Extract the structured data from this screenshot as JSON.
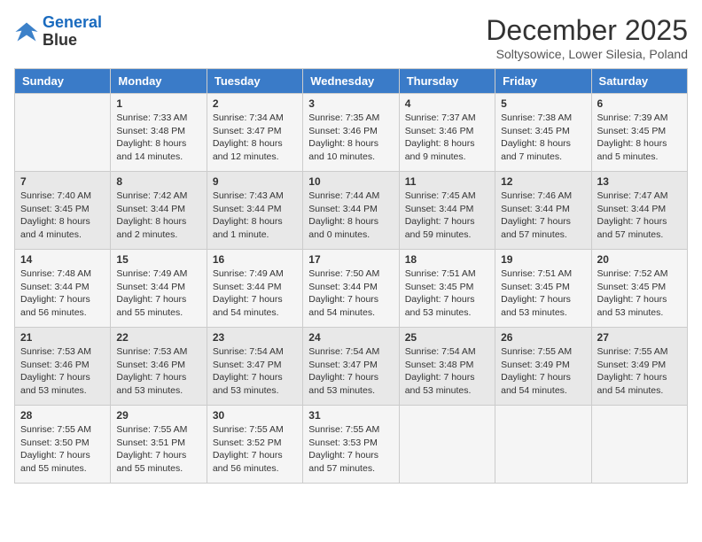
{
  "logo": {
    "line1": "General",
    "line2": "Blue"
  },
  "title": "December 2025",
  "subtitle": "Soltysowice, Lower Silesia, Poland",
  "days_header": [
    "Sunday",
    "Monday",
    "Tuesday",
    "Wednesday",
    "Thursday",
    "Friday",
    "Saturday"
  ],
  "weeks": [
    [
      {
        "day": "",
        "content": ""
      },
      {
        "day": "1",
        "content": "Sunrise: 7:33 AM\nSunset: 3:48 PM\nDaylight: 8 hours\nand 14 minutes."
      },
      {
        "day": "2",
        "content": "Sunrise: 7:34 AM\nSunset: 3:47 PM\nDaylight: 8 hours\nand 12 minutes."
      },
      {
        "day": "3",
        "content": "Sunrise: 7:35 AM\nSunset: 3:46 PM\nDaylight: 8 hours\nand 10 minutes."
      },
      {
        "day": "4",
        "content": "Sunrise: 7:37 AM\nSunset: 3:46 PM\nDaylight: 8 hours\nand 9 minutes."
      },
      {
        "day": "5",
        "content": "Sunrise: 7:38 AM\nSunset: 3:45 PM\nDaylight: 8 hours\nand 7 minutes."
      },
      {
        "day": "6",
        "content": "Sunrise: 7:39 AM\nSunset: 3:45 PM\nDaylight: 8 hours\nand 5 minutes."
      }
    ],
    [
      {
        "day": "7",
        "content": "Sunrise: 7:40 AM\nSunset: 3:45 PM\nDaylight: 8 hours\nand 4 minutes."
      },
      {
        "day": "8",
        "content": "Sunrise: 7:42 AM\nSunset: 3:44 PM\nDaylight: 8 hours\nand 2 minutes."
      },
      {
        "day": "9",
        "content": "Sunrise: 7:43 AM\nSunset: 3:44 PM\nDaylight: 8 hours\nand 1 minute."
      },
      {
        "day": "10",
        "content": "Sunrise: 7:44 AM\nSunset: 3:44 PM\nDaylight: 8 hours\nand 0 minutes."
      },
      {
        "day": "11",
        "content": "Sunrise: 7:45 AM\nSunset: 3:44 PM\nDaylight: 7 hours\nand 59 minutes."
      },
      {
        "day": "12",
        "content": "Sunrise: 7:46 AM\nSunset: 3:44 PM\nDaylight: 7 hours\nand 57 minutes."
      },
      {
        "day": "13",
        "content": "Sunrise: 7:47 AM\nSunset: 3:44 PM\nDaylight: 7 hours\nand 57 minutes."
      }
    ],
    [
      {
        "day": "14",
        "content": "Sunrise: 7:48 AM\nSunset: 3:44 PM\nDaylight: 7 hours\nand 56 minutes."
      },
      {
        "day": "15",
        "content": "Sunrise: 7:49 AM\nSunset: 3:44 PM\nDaylight: 7 hours\nand 55 minutes."
      },
      {
        "day": "16",
        "content": "Sunrise: 7:49 AM\nSunset: 3:44 PM\nDaylight: 7 hours\nand 54 minutes."
      },
      {
        "day": "17",
        "content": "Sunrise: 7:50 AM\nSunset: 3:44 PM\nDaylight: 7 hours\nand 54 minutes."
      },
      {
        "day": "18",
        "content": "Sunrise: 7:51 AM\nSunset: 3:45 PM\nDaylight: 7 hours\nand 53 minutes."
      },
      {
        "day": "19",
        "content": "Sunrise: 7:51 AM\nSunset: 3:45 PM\nDaylight: 7 hours\nand 53 minutes."
      },
      {
        "day": "20",
        "content": "Sunrise: 7:52 AM\nSunset: 3:45 PM\nDaylight: 7 hours\nand 53 minutes."
      }
    ],
    [
      {
        "day": "21",
        "content": "Sunrise: 7:53 AM\nSunset: 3:46 PM\nDaylight: 7 hours\nand 53 minutes."
      },
      {
        "day": "22",
        "content": "Sunrise: 7:53 AM\nSunset: 3:46 PM\nDaylight: 7 hours\nand 53 minutes."
      },
      {
        "day": "23",
        "content": "Sunrise: 7:54 AM\nSunset: 3:47 PM\nDaylight: 7 hours\nand 53 minutes."
      },
      {
        "day": "24",
        "content": "Sunrise: 7:54 AM\nSunset: 3:47 PM\nDaylight: 7 hours\nand 53 minutes."
      },
      {
        "day": "25",
        "content": "Sunrise: 7:54 AM\nSunset: 3:48 PM\nDaylight: 7 hours\nand 53 minutes."
      },
      {
        "day": "26",
        "content": "Sunrise: 7:55 AM\nSunset: 3:49 PM\nDaylight: 7 hours\nand 54 minutes."
      },
      {
        "day": "27",
        "content": "Sunrise: 7:55 AM\nSunset: 3:49 PM\nDaylight: 7 hours\nand 54 minutes."
      }
    ],
    [
      {
        "day": "28",
        "content": "Sunrise: 7:55 AM\nSunset: 3:50 PM\nDaylight: 7 hours\nand 55 minutes."
      },
      {
        "day": "29",
        "content": "Sunrise: 7:55 AM\nSunset: 3:51 PM\nDaylight: 7 hours\nand 55 minutes."
      },
      {
        "day": "30",
        "content": "Sunrise: 7:55 AM\nSunset: 3:52 PM\nDaylight: 7 hours\nand 56 minutes."
      },
      {
        "day": "31",
        "content": "Sunrise: 7:55 AM\nSunset: 3:53 PM\nDaylight: 7 hours\nand 57 minutes."
      },
      {
        "day": "",
        "content": ""
      },
      {
        "day": "",
        "content": ""
      },
      {
        "day": "",
        "content": ""
      }
    ]
  ]
}
